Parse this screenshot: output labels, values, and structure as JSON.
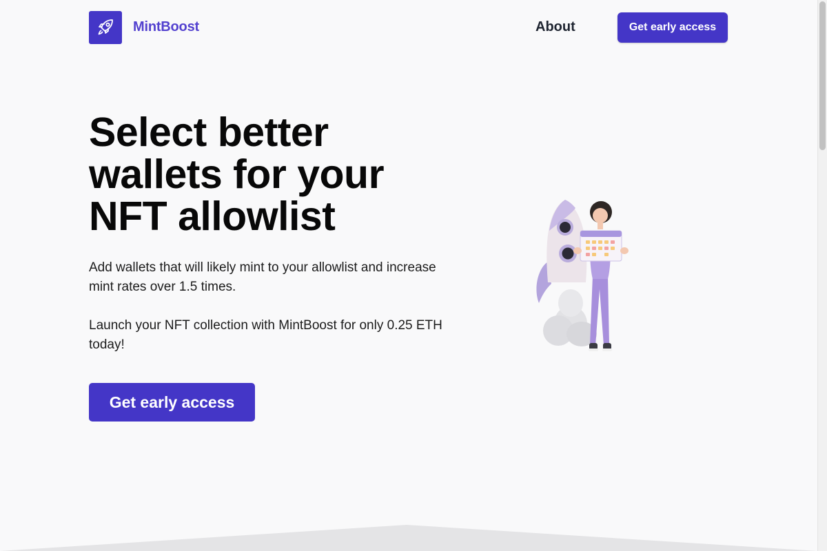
{
  "header": {
    "logo_icon": "rocket-icon",
    "brand": "MintBoost",
    "nav_about": "About",
    "cta_label": "Get early access"
  },
  "hero": {
    "title_line1": "Select better",
    "title_line2": "wallets for your",
    "title_line3": "NFT allowlist",
    "paragraph1": "Add wallets that will likely mint to your allowlist and increase mint rates over 1.5 times.",
    "paragraph2": "Launch your NFT collection with MintBoost for only 0.25 ETH today!",
    "cta_label": "Get early access",
    "illustration": "woman-with-calendar-and-rocket-illustration"
  },
  "colors": {
    "accent": "#4436c7",
    "brand_text": "#5341cf",
    "background": "#f9f9fa"
  }
}
